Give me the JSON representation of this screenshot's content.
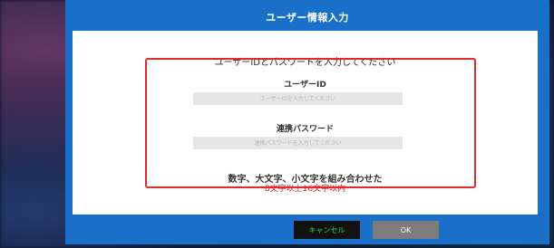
{
  "dialog": {
    "title": "ユーザー情報入力",
    "instruction": "ユーザーIDとパスワードを入力してください",
    "user_id": {
      "label": "ユーザーID",
      "placeholder": "ユーザーIDを入力してください",
      "value": ""
    },
    "password": {
      "label": "連携パスワード",
      "placeholder": "連携パスワードを入力してください",
      "value": ""
    },
    "rule_text": "数字、大文字、小文字を組み合わせた",
    "rule_subtext": "8文字以上16文字以内",
    "buttons": {
      "cancel_label": "キャンセル",
      "ok_label": "OK"
    }
  },
  "colors": {
    "dialog_frame": "#1a70c8",
    "highlight_border": "#e8262d",
    "cancel_text": "#2ddc4c",
    "cancel_background": "#111111",
    "ok_background": "#7c7c7c",
    "rule_subtext": "#e02020"
  }
}
